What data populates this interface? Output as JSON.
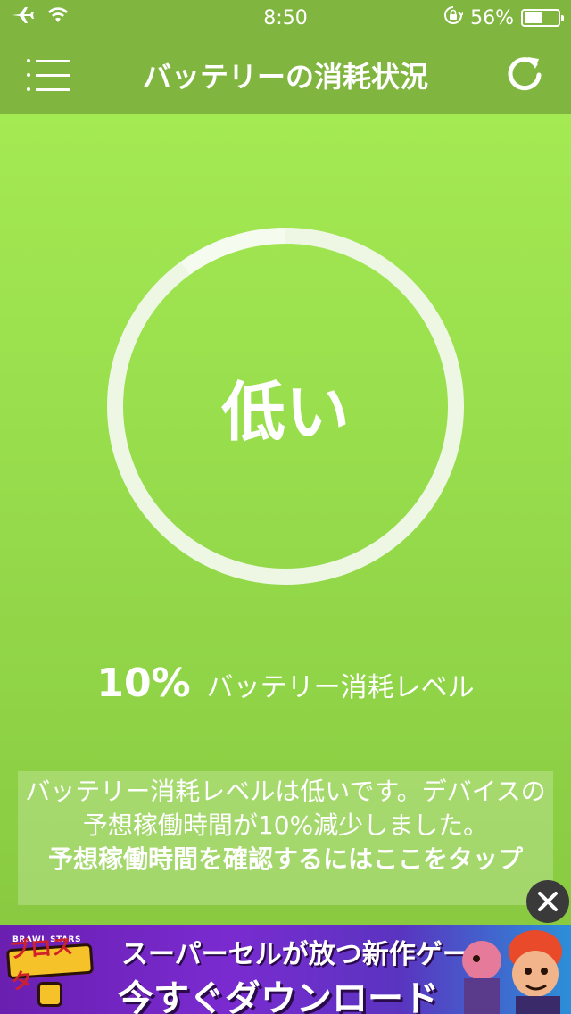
{
  "status_bar": {
    "time": "8:50",
    "battery_percent": "56%",
    "battery_level": 0.56,
    "icons": [
      "airplane-icon",
      "wifi-icon",
      "orientation-lock-icon",
      "battery-icon"
    ]
  },
  "nav": {
    "title": "バッテリーの消耗状況",
    "menu_icon": "list-menu-icon",
    "refresh_icon": "refresh-icon"
  },
  "gauge": {
    "label": "低い",
    "fraction": 0.1
  },
  "level": {
    "percent": "10%",
    "label": "バッテリー消耗レベル"
  },
  "info": {
    "text": "バッテリー消耗レベルは低いです。デバイスの予想稼働時間が10%減少しました。",
    "cta": "予想稼働時間を確認するにはここをタップ"
  },
  "ad": {
    "logo_top": "BRAWL STARS",
    "logo_main": "ブロスタ",
    "line1": "スーパーセルが放つ新作ゲーム",
    "line2": "今すぐダウンロード",
    "close_icon": "close-icon"
  },
  "colors": {
    "bar": "#80b640",
    "background": "#9ad94c",
    "ring": "#eef7e4"
  }
}
